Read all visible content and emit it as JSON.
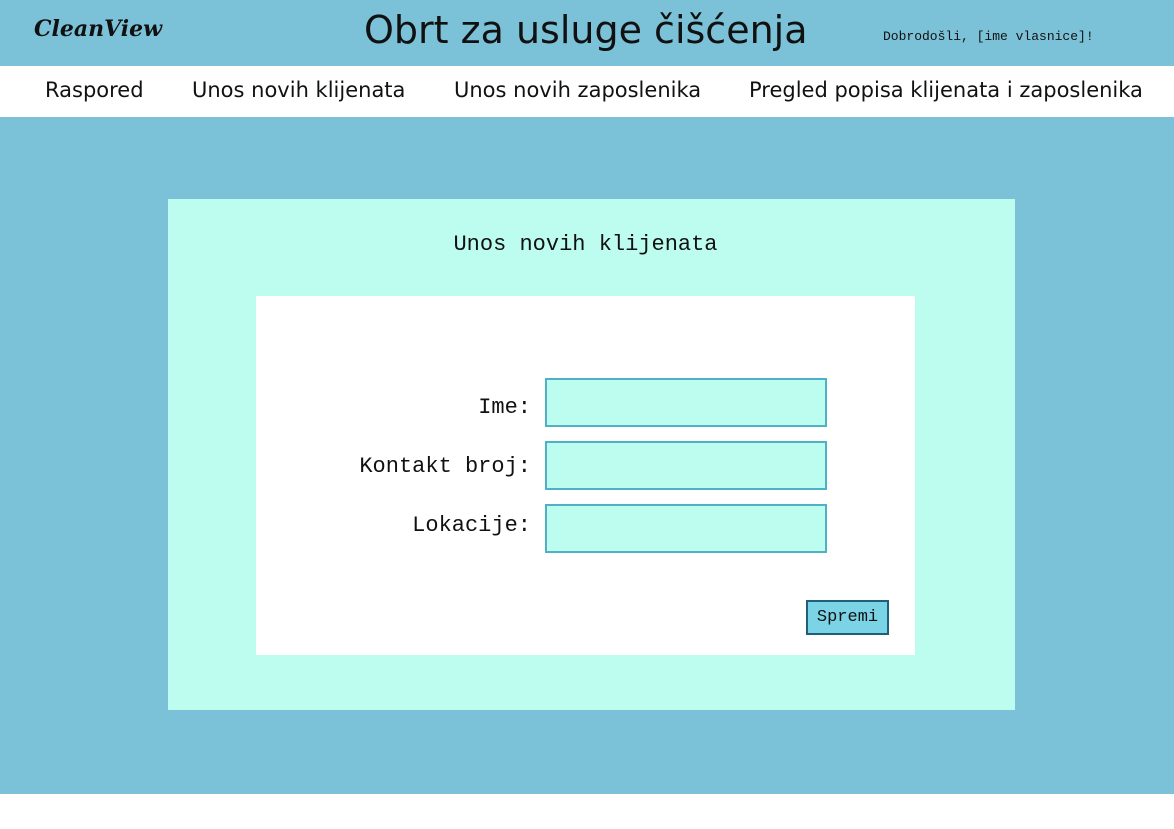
{
  "header": {
    "logo": "CleanView",
    "title": "Obrt za usluge čišćenja",
    "welcome": "Dobrodošli, [ime vlasnice]!"
  },
  "nav": {
    "items": [
      "Raspored",
      "Unos novih klijenata",
      "Unos novih zaposlenika",
      "Pregled popisa klijenata i zaposlenika"
    ]
  },
  "form": {
    "title": "Unos novih klijenata",
    "fields": [
      {
        "label": "Ime:",
        "value": ""
      },
      {
        "label": "Kontakt broj:",
        "value": ""
      },
      {
        "label": "Lokacije:",
        "value": ""
      }
    ],
    "save_label": "Spremi"
  },
  "colors": {
    "header_bg": "#7bc2d9",
    "panel_bg": "#bcfdf0",
    "input_border": "#4fb0c6",
    "button_bg": "#7bd3e6"
  }
}
